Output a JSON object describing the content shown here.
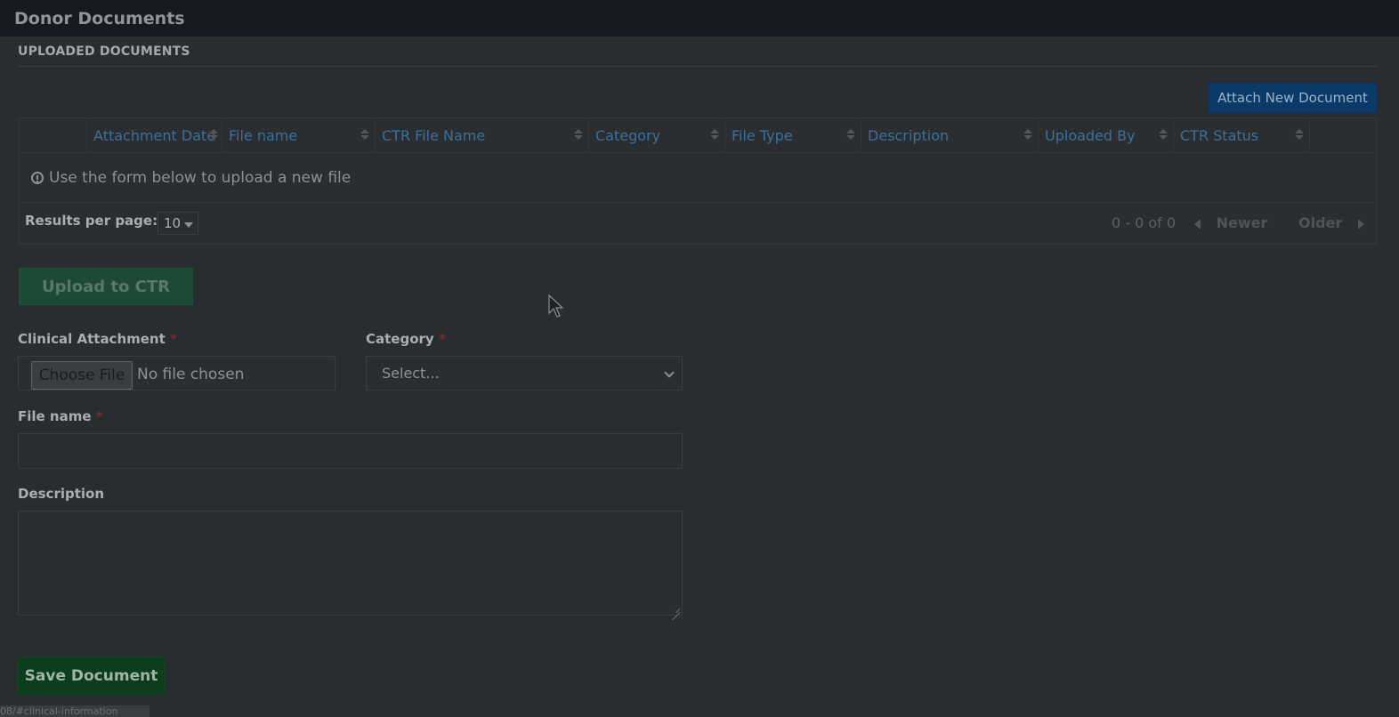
{
  "window": {
    "title": "Donor Documents"
  },
  "section": {
    "title": "UPLOADED DOCUMENTS"
  },
  "toolbar": {
    "attach_label": "Attach New Document"
  },
  "table": {
    "columns": [
      {
        "label": "Attachment Date"
      },
      {
        "label": "File name"
      },
      {
        "label": "CTR File Name"
      },
      {
        "label": "Category"
      },
      {
        "label": "File Type"
      },
      {
        "label": "Description"
      },
      {
        "label": "Uploaded By"
      },
      {
        "label": "CTR Status"
      }
    ],
    "empty_message": "Use the form below to upload a new file",
    "results_per_page_label": "Results per page:",
    "results_per_page_value": "10",
    "range_text": "0 - 0 of 0",
    "newer_label": "Newer",
    "older_label": "Older"
  },
  "form": {
    "upload_ctr_label": "Upload to CTR",
    "clinical_attachment_label": "Clinical Attachment",
    "required_mark": "*",
    "choose_file_label": "Choose File",
    "no_file_text": "No file chosen",
    "category_label": "Category",
    "category_selected": "Select...",
    "file_name_label": "File name",
    "file_name_value": "",
    "description_label": "Description",
    "description_value": "",
    "save_label": "Save Document"
  },
  "status_bar": {
    "url": "08/#clinical-information"
  }
}
